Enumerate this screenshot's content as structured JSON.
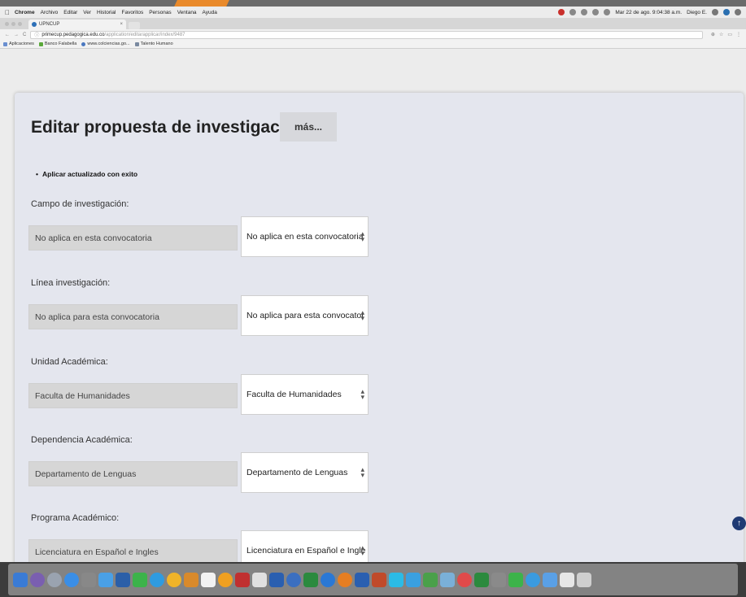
{
  "menubar": {
    "items": [
      "Chrome",
      "Archivo",
      "Editar",
      "Ver",
      "Historial",
      "Favoritos",
      "Personas",
      "Ventana",
      "Ayuda"
    ],
    "clock": "Mar 22 de ago. 9:04:38 a.m.",
    "user": "Diego E."
  },
  "browser": {
    "tab_title": "UPNCUP",
    "url_host": "primecup.pedagogica.edu.co",
    "url_path": "/application/editarapplicar/index/9487",
    "bookmarks": [
      "Aplicaciones",
      "Banco Falabella",
      "www.colciencias.go...",
      "Talento Humano"
    ]
  },
  "page": {
    "title": "Editar propuesta de investigación",
    "more_button": "más...",
    "flash_message": "Aplicar actualizado con exito",
    "fields": [
      {
        "label": "Campo de investigación:",
        "current": "No aplica en esta convocatoria",
        "selected": "No aplica en esta convocatoria"
      },
      {
        "label": "Línea investigación:",
        "current": "No aplica para esta convocatoria",
        "selected": "No aplica para esta convocator"
      },
      {
        "label": "Unidad Académica:",
        "current": "Faculta de Humanidades",
        "selected": "Faculta de Humanidades"
      },
      {
        "label": "Dependencia Académica:",
        "current": "Departamento de Lenguas",
        "selected": "Departamento de Lenguas"
      },
      {
        "label": "Programa Académico:",
        "current": "Licenciatura en Español e Ingles",
        "selected": "Licenciatura en Español e Ingle"
      }
    ]
  },
  "colors": {
    "accent": "#e98a2b",
    "card_bg": "#e4e6ee",
    "scroll_button": "#1f3a73"
  },
  "icons": {
    "scroll_up": "arrow-up-icon",
    "select_caret": "updown-caret-icon"
  }
}
